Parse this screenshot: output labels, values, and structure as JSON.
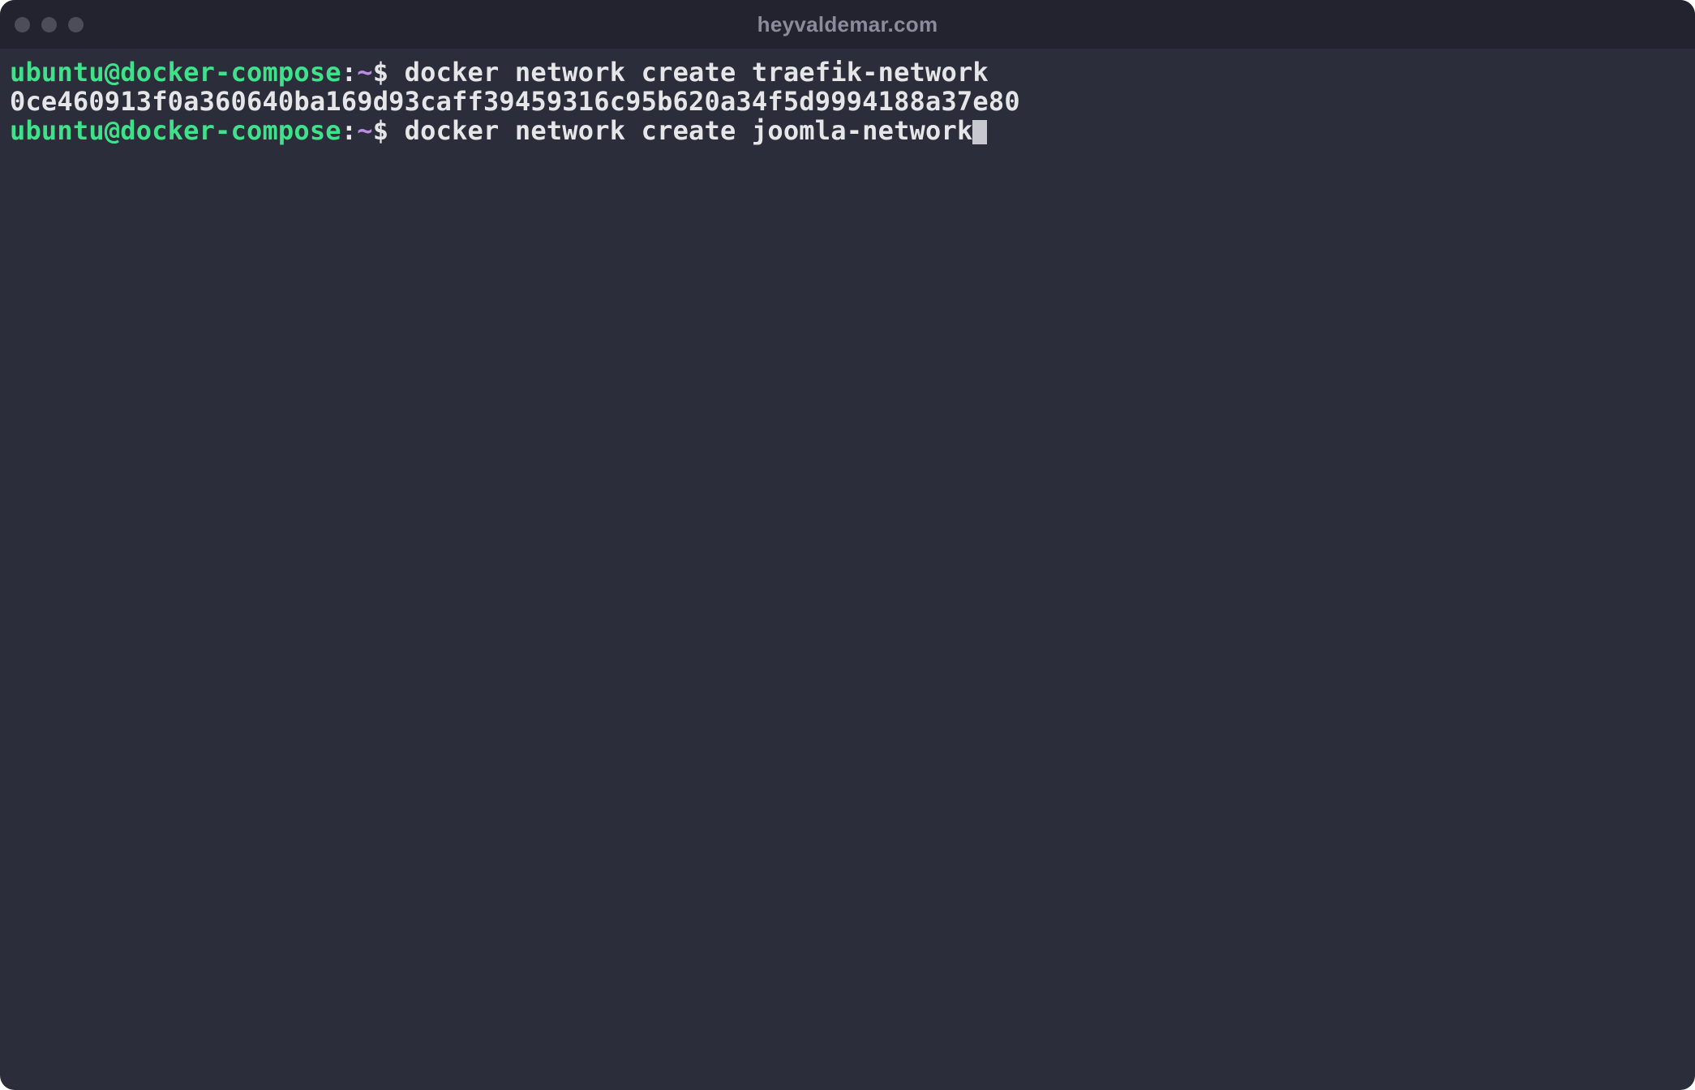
{
  "titlebar": {
    "title": "heyvaldemar.com"
  },
  "prompt": {
    "user_host": "ubuntu@docker-compose",
    "colon": ":",
    "path": "~",
    "dollar": "$"
  },
  "lines": {
    "cmd1": " docker network create traefik-network",
    "out1": "0ce460913f0a360640ba169d93caff39459316c95b620a34f5d9994188a37e80",
    "cmd2": " docker network create joomla-network"
  },
  "colors": {
    "bg": "#2b2d3a",
    "titlebar_bg": "#22232e",
    "prompt_user": "#3fe28a",
    "prompt_path": "#b98de0",
    "text": "#e6e6e9",
    "title_text": "#8a8c99",
    "traffic_light": "#4b4d58",
    "cursor": "#c8c9d0"
  }
}
